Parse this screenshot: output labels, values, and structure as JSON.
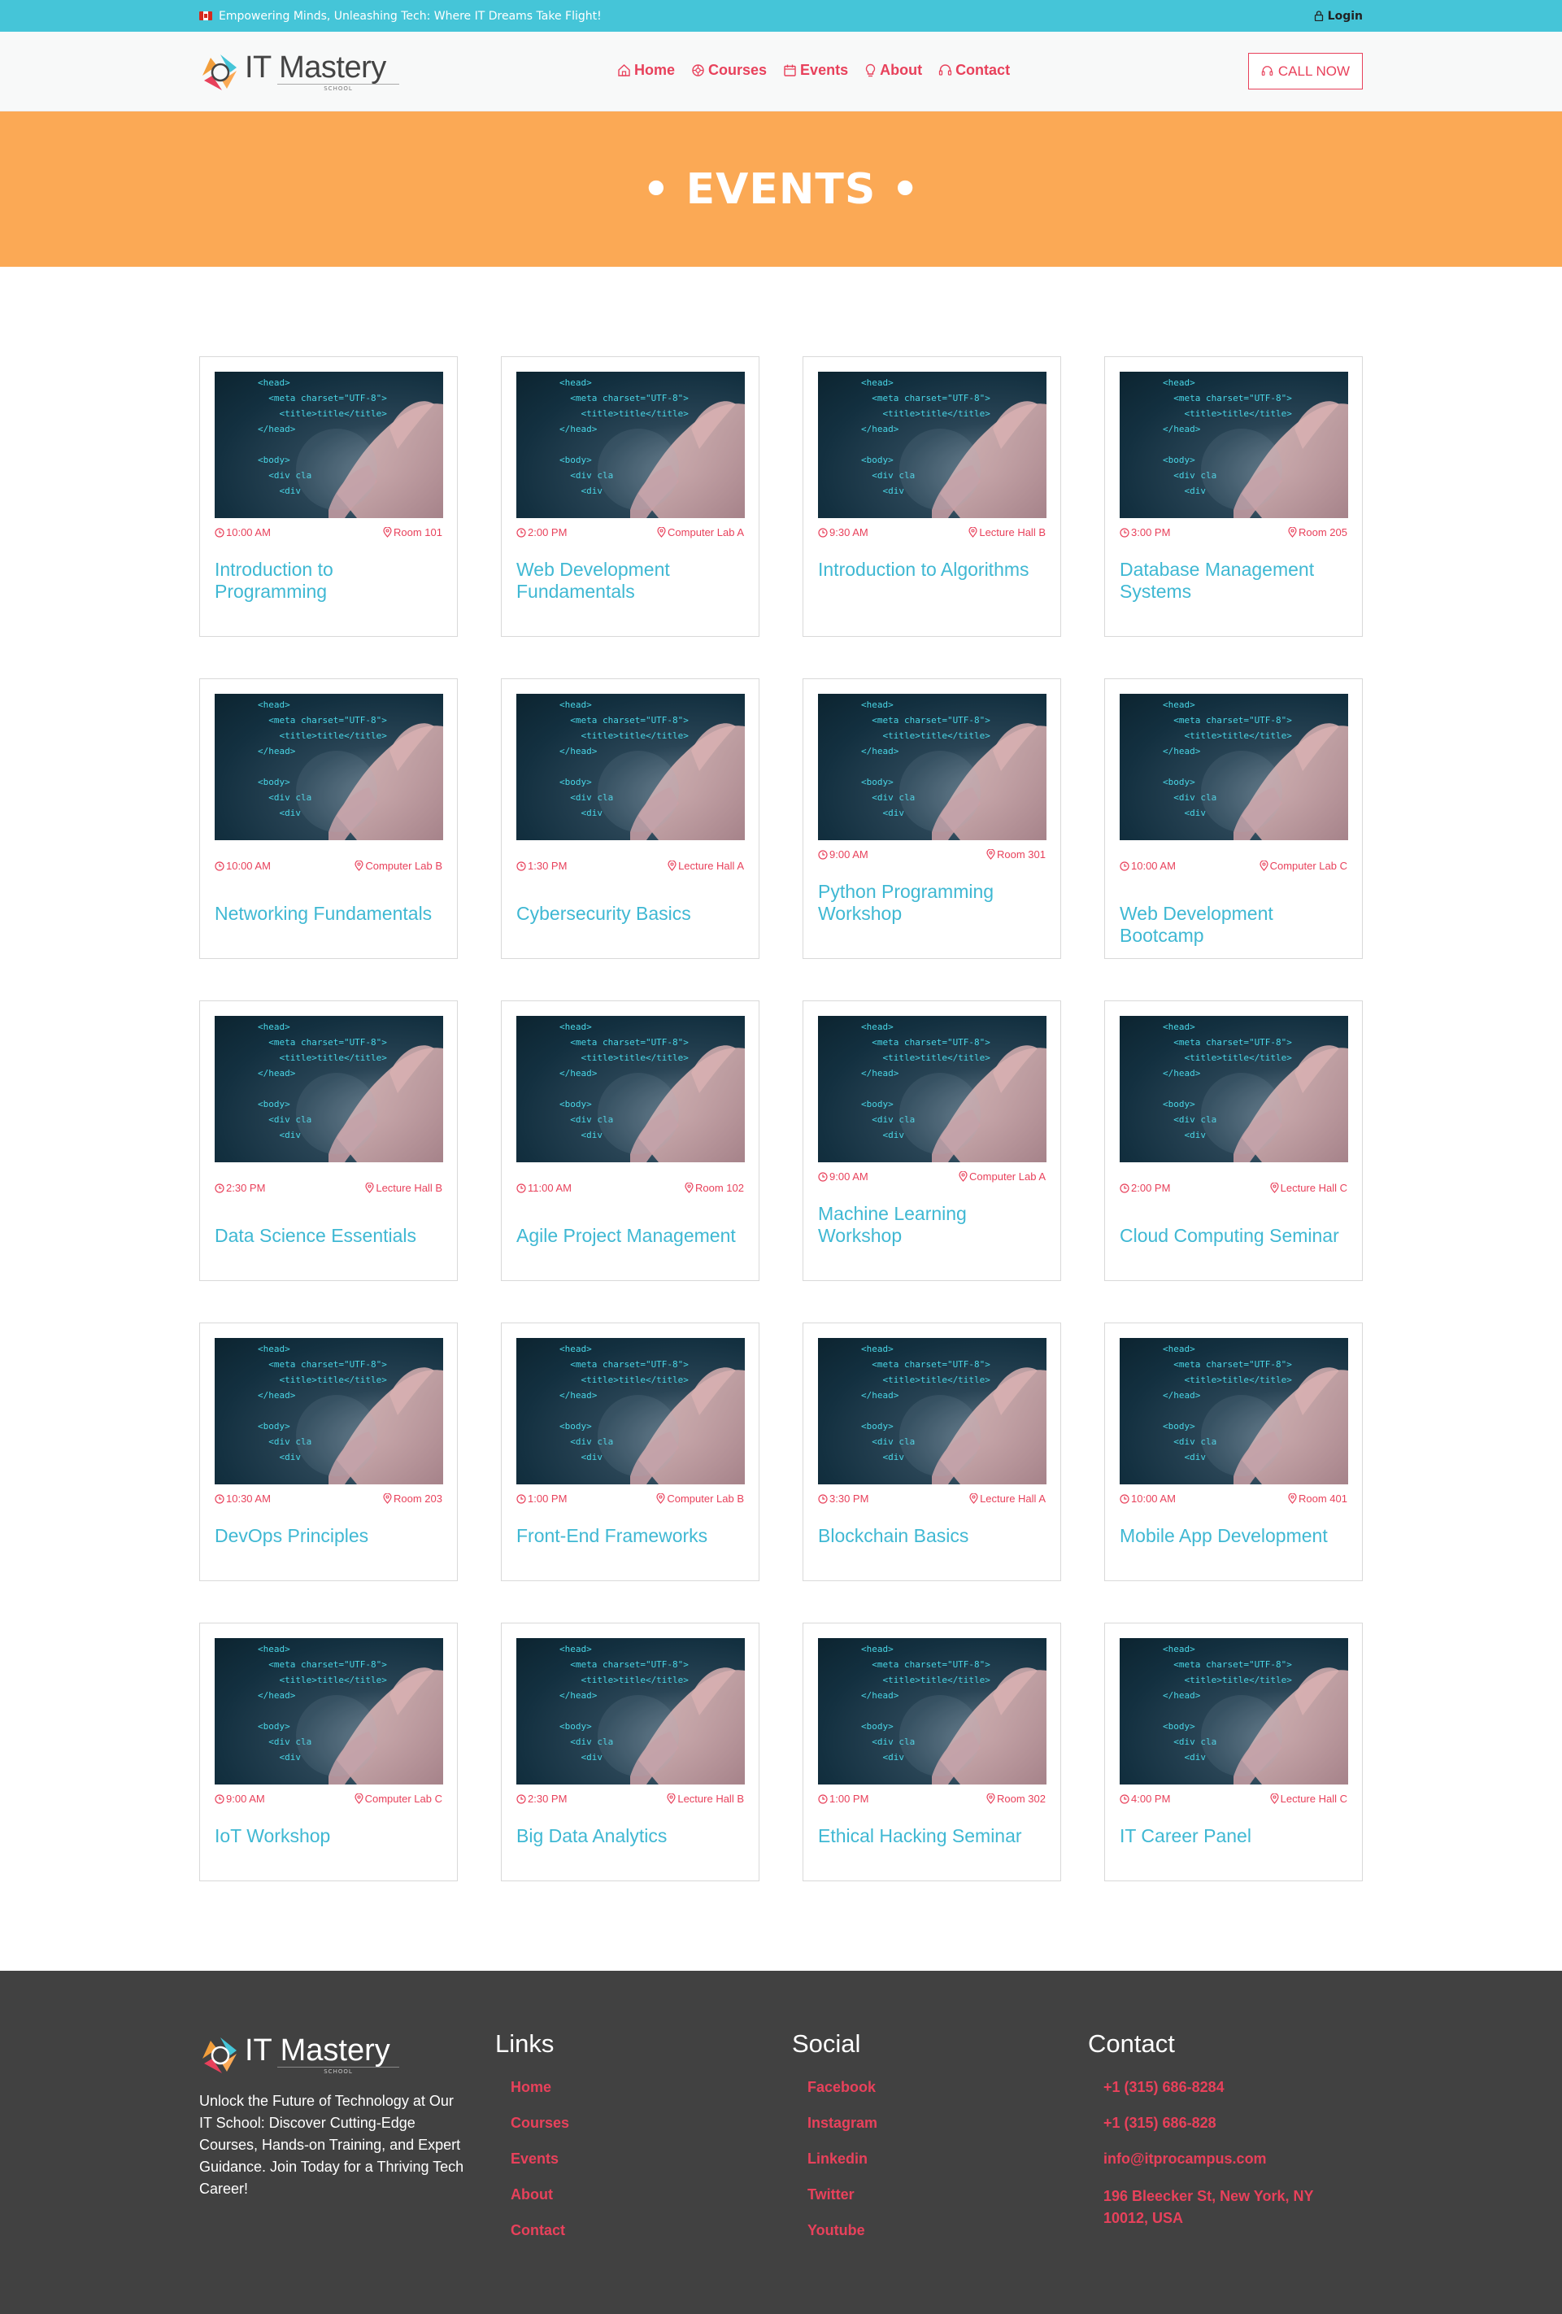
{
  "topbar": {
    "tagline": "Empowering Minds, Unleashing Tech: Where IT Dreams Take Flight!",
    "login_label": "Login"
  },
  "header": {
    "logo_text": "IT Mastery",
    "logo_sub": "SCHOOL",
    "nav": [
      {
        "label": "Home",
        "icon": "home-icon"
      },
      {
        "label": "Courses",
        "icon": "courses-icon"
      },
      {
        "label": "Events",
        "icon": "calendar-icon"
      },
      {
        "label": "About",
        "icon": "bulb-icon"
      },
      {
        "label": "Contact",
        "icon": "headset-icon"
      }
    ],
    "call_label": "CALL NOW"
  },
  "hero": {
    "title": "• EVENTS •"
  },
  "events": [
    {
      "time": "10:00 AM",
      "room": "Room 101",
      "title": "Introduction to Programming"
    },
    {
      "time": "2:00 PM",
      "room": "Computer Lab A",
      "title": "Web Development Fundamentals"
    },
    {
      "time": "9:30 AM",
      "room": "Lecture Hall B",
      "title": "Introduction to Algorithms"
    },
    {
      "time": "3:00 PM",
      "room": "Room 205",
      "title": "Database Management Systems"
    },
    {
      "time": "10:00 AM",
      "room": "Computer Lab B",
      "title": "Networking Fundamentals"
    },
    {
      "time": "1:30 PM",
      "room": "Lecture Hall A",
      "title": "Cybersecurity Basics"
    },
    {
      "time": "9:00 AM",
      "room": "Room 301",
      "title": "Python Programming Workshop"
    },
    {
      "time": "10:00 AM",
      "room": "Computer Lab C",
      "title": "Web Development Bootcamp"
    },
    {
      "time": "2:30 PM",
      "room": "Lecture Hall B",
      "title": "Data Science Essentials"
    },
    {
      "time": "11:00 AM",
      "room": "Room 102",
      "title": "Agile Project Management"
    },
    {
      "time": "9:00 AM",
      "room": "Computer Lab A",
      "title": "Machine Learning Workshop"
    },
    {
      "time": "2:00 PM",
      "room": "Lecture Hall C",
      "title": "Cloud Computing Seminar"
    },
    {
      "time": "10:30 AM",
      "room": "Room 203",
      "title": "DevOps Principles"
    },
    {
      "time": "1:00 PM",
      "room": "Computer Lab B",
      "title": "Front-End Frameworks"
    },
    {
      "time": "3:30 PM",
      "room": "Lecture Hall A",
      "title": "Blockchain Basics"
    },
    {
      "time": "10:00 AM",
      "room": "Room 401",
      "title": "Mobile App Development"
    },
    {
      "time": "9:00 AM",
      "room": "Computer Lab C",
      "title": "IoT Workshop"
    },
    {
      "time": "2:30 PM",
      "room": "Lecture Hall B",
      "title": "Big Data Analytics"
    },
    {
      "time": "1:00 PM",
      "room": "Room 302",
      "title": "Ethical Hacking Seminar"
    },
    {
      "time": "4:00 PM",
      "room": "Lecture Hall C",
      "title": "IT Career Panel"
    }
  ],
  "footer": {
    "about": "Unlock the Future of Technology at Our IT School: Discover Cutting-Edge Courses, Hands-on Training, and Expert Guidance. Join Today for a Thriving Tech Career!",
    "links_heading": "Links",
    "links": [
      "Home",
      "Courses",
      "Events",
      "About",
      "Contact"
    ],
    "social_heading": "Social",
    "social": [
      "Facebook",
      "Instagram",
      "Linkedin",
      "Twitter",
      "Youtube"
    ],
    "contact_heading": "Contact",
    "contact": [
      "+1 (315) 686-8284",
      "+1 (315) 686-828",
      "info@itprocampus.com",
      "196 Bleecker St, New York, NY 10012, USA"
    ]
  },
  "colors": {
    "accent": "#e8415b",
    "teal": "#45c5d8",
    "hero": "#fba955",
    "footer": "#414141",
    "title": "#3fb8d3"
  }
}
